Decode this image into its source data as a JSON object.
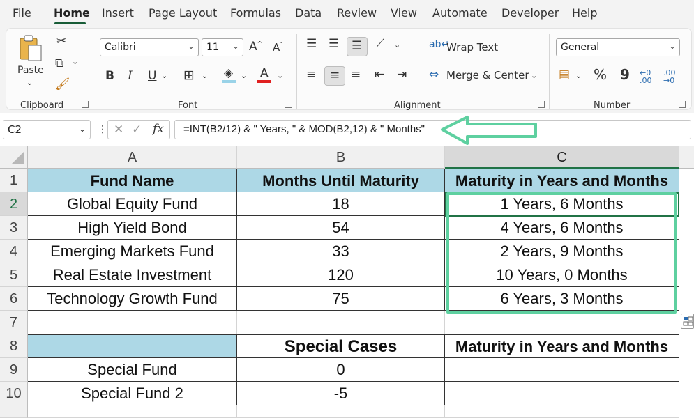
{
  "menu": {
    "tabs": [
      "File",
      "Home",
      "Insert",
      "Page Layout",
      "Formulas",
      "Data",
      "Review",
      "View",
      "Automate",
      "Developer",
      "Help"
    ],
    "active": "Home"
  },
  "ribbon": {
    "clipboard": {
      "paste_label": "Paste",
      "group_label": "Clipboard"
    },
    "font": {
      "font_name": "Calibri",
      "font_size": "11",
      "group_label": "Font",
      "bold": "B",
      "italic": "I",
      "underline": "U"
    },
    "alignment": {
      "wrap_text": "Wrap Text",
      "merge_center": "Merge & Center",
      "group_label": "Alignment"
    },
    "number": {
      "format": "General",
      "group_label": "Number",
      "percent": "%",
      "comma": "9"
    }
  },
  "formula_bar": {
    "name_box": "C2",
    "fx": "fx",
    "formula": "=INT(B2/12) & \" Years, \" & MOD(B2,12) & \" Months\""
  },
  "accent_color": "#5ed0a0",
  "sheet": {
    "columns": [
      "A",
      "B",
      "C"
    ],
    "rows": [
      "1",
      "2",
      "3",
      "4",
      "5",
      "6",
      "7",
      "8",
      "9",
      "10"
    ],
    "header": [
      "Fund Name",
      "Months Until Maturity",
      "Maturity in Years and Months"
    ],
    "data": [
      [
        "Global Equity Fund",
        "18",
        "1 Years, 6 Months"
      ],
      [
        "High Yield Bond",
        "54",
        "4 Years, 6 Months"
      ],
      [
        "Emerging Markets Fund",
        "33",
        "2 Years, 9 Months"
      ],
      [
        "Real Estate Investment",
        "120",
        "10 Years, 0 Months"
      ],
      [
        "Technology Growth Fund",
        "75",
        "6 Years, 3 Months"
      ]
    ],
    "special_header": [
      "",
      "Special Cases",
      "Maturity in Years and Months"
    ],
    "special_data": [
      [
        "Special Fund",
        "0",
        ""
      ],
      [
        "Special Fund 2",
        "-5",
        ""
      ]
    ]
  }
}
